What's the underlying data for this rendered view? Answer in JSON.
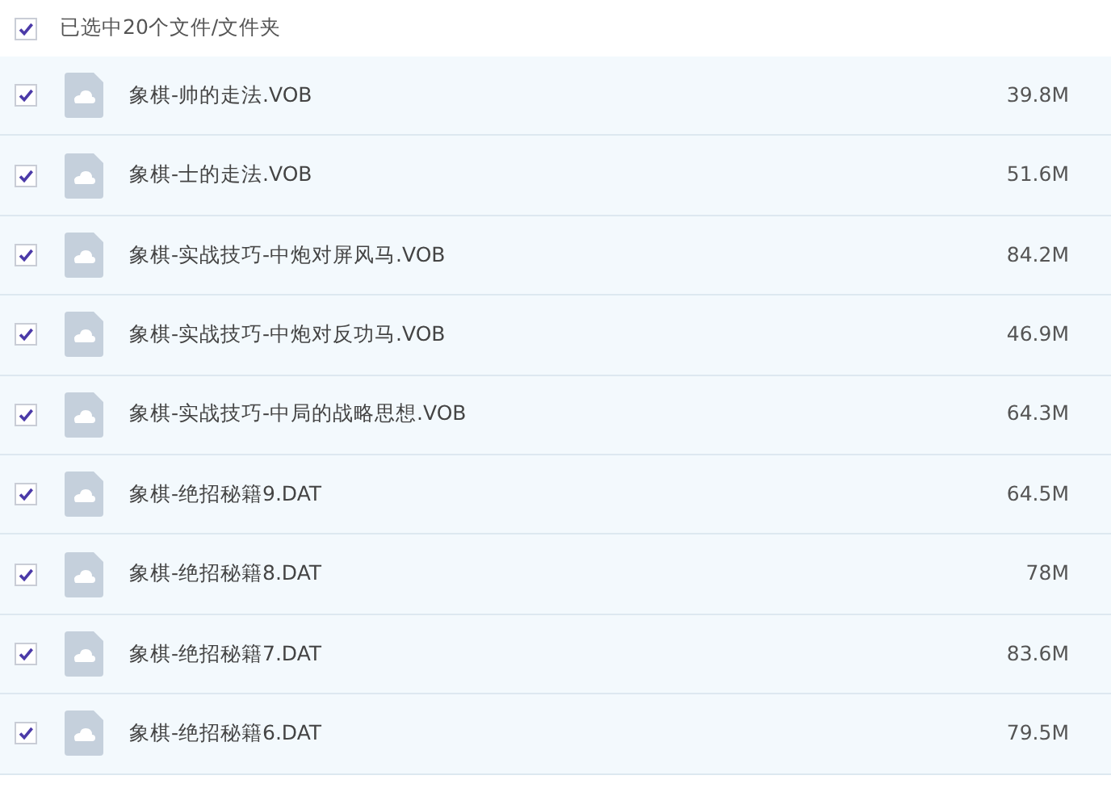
{
  "header": {
    "label": "已选中20个文件/文件夹",
    "checked": true
  },
  "files": [
    {
      "name": "象棋-帅的走法.VOB",
      "size": "39.8M",
      "checked": true
    },
    {
      "name": "象棋-士的走法.VOB",
      "size": "51.6M",
      "checked": true
    },
    {
      "name": "象棋-实战技巧-中炮对屏风马.VOB",
      "size": "84.2M",
      "checked": true
    },
    {
      "name": "象棋-实战技巧-中炮对反功马.VOB",
      "size": "46.9M",
      "checked": true
    },
    {
      "name": "象棋-实战技巧-中局的战略思想.VOB",
      "size": "64.3M",
      "checked": true
    },
    {
      "name": "象棋-绝招秘籍9.DAT",
      "size": "64.5M",
      "checked": true
    },
    {
      "name": "象棋-绝招秘籍8.DAT",
      "size": "78M",
      "checked": true
    },
    {
      "name": "象棋-绝招秘籍7.DAT",
      "size": "83.6M",
      "checked": true
    },
    {
      "name": "象棋-绝招秘籍6.DAT",
      "size": "79.5M",
      "checked": true
    }
  ]
}
